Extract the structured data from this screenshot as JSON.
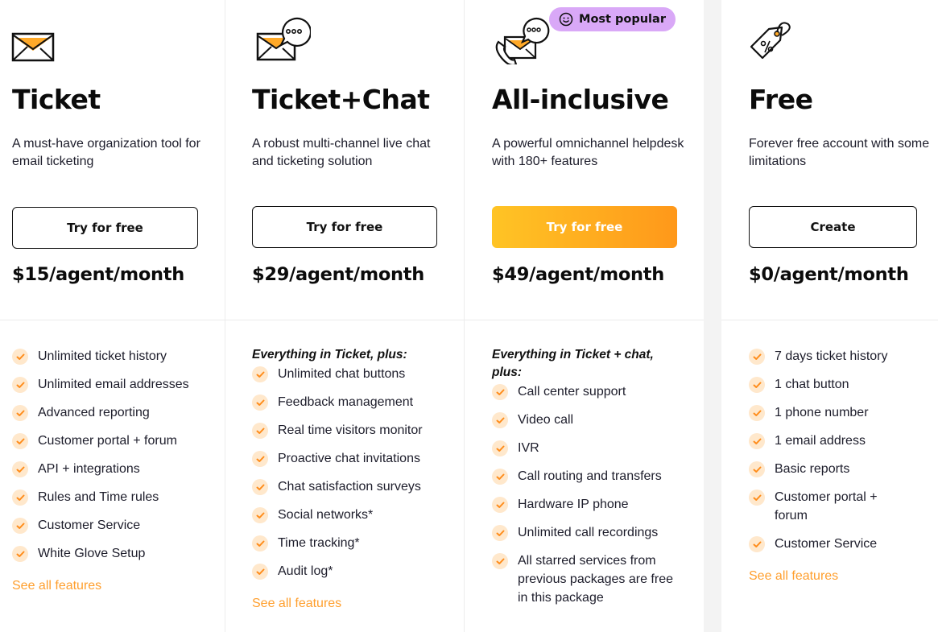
{
  "badge": {
    "label": "Most popular",
    "icon": "smile-icon"
  },
  "colors": {
    "accent": "#ff9f2e",
    "check_bg": "#ffe8cc",
    "badge_bg": "#d9a8f7",
    "primary_gradient_start": "#ffc425",
    "primary_gradient_end": "#ff981a"
  },
  "plans": [
    {
      "icon": "envelope-icon",
      "name": "Ticket",
      "description": "A must-have organization tool for email ticketing",
      "cta": "Try for free",
      "price": "$15/agent/month",
      "features_intro": "",
      "features": [
        "Unlimited ticket history",
        "Unlimited email addresses",
        "Advanced reporting",
        "Customer portal + forum",
        "API + integrations",
        "Rules and Time rules",
        "Customer Service",
        "White Glove Setup"
      ],
      "see_all": "See all features"
    },
    {
      "icon": "envelope-chat-icon",
      "name": "Ticket+Chat",
      "description": "A robust multi-channel live chat and ticketing solution",
      "cta": "Try for free",
      "price": "$29/agent/month",
      "features_intro": "Everything in Ticket, plus:",
      "features": [
        "Unlimited chat buttons",
        "Feedback management",
        "Real time visitors monitor",
        "Proactive chat invitations",
        "Chat satisfaction surveys",
        "Social networks*",
        "Time tracking*",
        "Audit log*"
      ],
      "see_all": "See all features"
    },
    {
      "icon": "envelope-chat-phone-icon",
      "name": "All-inclusive",
      "description": "A powerful omnichannel helpdesk with 180+ features",
      "cta": "Try for free",
      "price": "$49/agent/month",
      "features_intro": "Everything in Ticket + chat, plus:",
      "features": [
        "Call center support",
        "Video call",
        "IVR",
        "Call routing and transfers",
        "Hardware IP phone",
        "Unlimited call recordings",
        "All starred services from previous packages are free in this package"
      ],
      "see_all": ""
    },
    {
      "icon": "price-tag-icon",
      "name": "Free",
      "description": "Forever free account with some limitations",
      "cta": "Create",
      "price": "$0/agent/month",
      "features_intro": "",
      "features": [
        "7 days ticket history",
        "1 chat button",
        "1 phone number",
        "1 email address",
        "Basic reports",
        "Customer portal + forum",
        "Customer Service"
      ],
      "see_all": "See all features"
    }
  ]
}
